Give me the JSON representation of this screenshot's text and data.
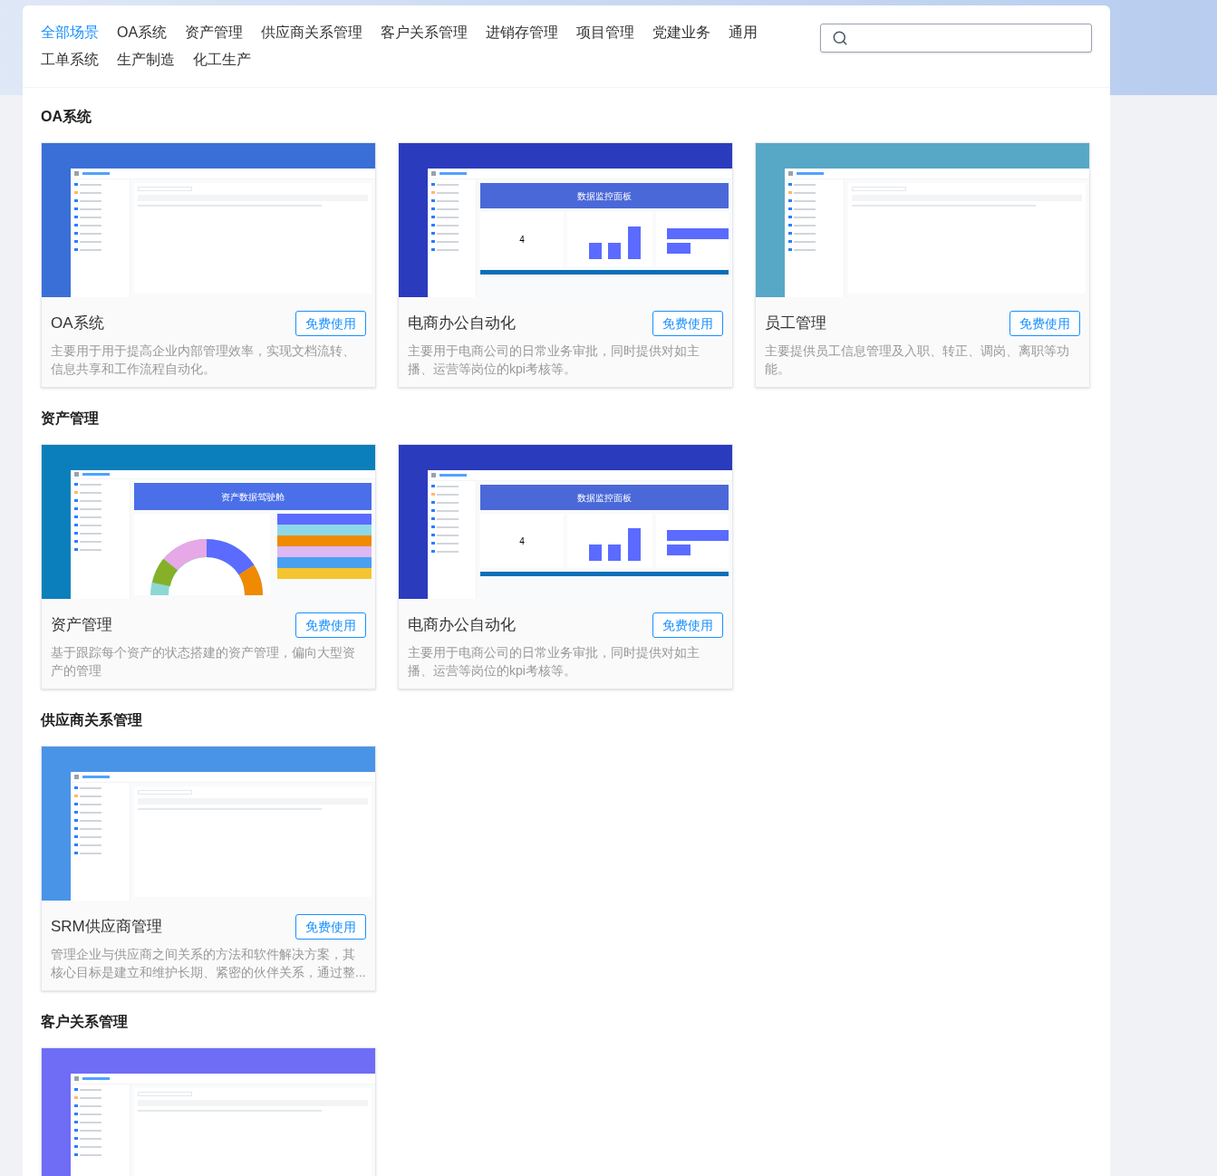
{
  "tabs": [
    {
      "label": "全部场景",
      "selected": true
    },
    {
      "label": "OA系统",
      "selected": false
    },
    {
      "label": "资产管理",
      "selected": false
    },
    {
      "label": "供应商关系管理",
      "selected": false
    },
    {
      "label": "客户关系管理",
      "selected": false
    },
    {
      "label": "进销存管理",
      "selected": false
    },
    {
      "label": "项目管理",
      "selected": false
    },
    {
      "label": "党建业务",
      "selected": false
    },
    {
      "label": "通用",
      "selected": false
    },
    {
      "label": "工单系统",
      "selected": false
    },
    {
      "label": "生产制造",
      "selected": false
    },
    {
      "label": "化工生产",
      "selected": false
    }
  ],
  "sections": [
    {
      "title": "OA系统",
      "cards": [
        {
          "preview": {
            "kind": "table",
            "color": "#3a6fd8"
          },
          "title": "OA系统",
          "button": "免费使用",
          "description": "主要用于用于提高企业内部管理效率，实现文档流转、信息共享和工作流程自动化。"
        },
        {
          "preview": {
            "kind": "dashboard",
            "color": "#2b3bbd",
            "heading": "数据监控面板",
            "value": "4"
          },
          "title": "电商办公自动化",
          "button": "免费使用",
          "description": "主要用于电商公司的日常业务审批，同时提供对如主播、运营等岗位的kpi考核等。"
        },
        {
          "preview": {
            "kind": "table",
            "color": "#56a8c6"
          },
          "title": "员工管理",
          "button": "免费使用",
          "description": "主要提供员工信息管理及入职、转正、调岗、离职等功能。"
        }
      ]
    },
    {
      "title": "资产管理",
      "cards": [
        {
          "preview": {
            "kind": "donut",
            "color": "#0b7fbb",
            "heading": "资产数据驾驶舱"
          },
          "title": "资产管理",
          "button": "免费使用",
          "description": "基于跟踪每个资产的状态搭建的资产管理，偏向大型资产的管理"
        },
        {
          "preview": {
            "kind": "dashboard",
            "color": "#2b3bbd",
            "heading": "数据监控面板",
            "value": "4"
          },
          "title": "电商办公自动化",
          "button": "免费使用",
          "description": "主要用于电商公司的日常业务审批，同时提供对如主播、运营等岗位的kpi考核等。"
        }
      ]
    },
    {
      "title": "供应商关系管理",
      "cards": [
        {
          "preview": {
            "kind": "table",
            "color": "#4a94e8"
          },
          "title": "SRM供应商管理",
          "button": "免费使用",
          "description": "管理企业与供应商之间关系的方法和软件解决方案，其核心目标是建立和维护长期、紧密的伙伴关系，通过整..."
        }
      ]
    },
    {
      "title": "客户关系管理",
      "cards": [
        {
          "preview": {
            "kind": "table",
            "color": "#6f6cf6"
          }
        }
      ]
    }
  ]
}
